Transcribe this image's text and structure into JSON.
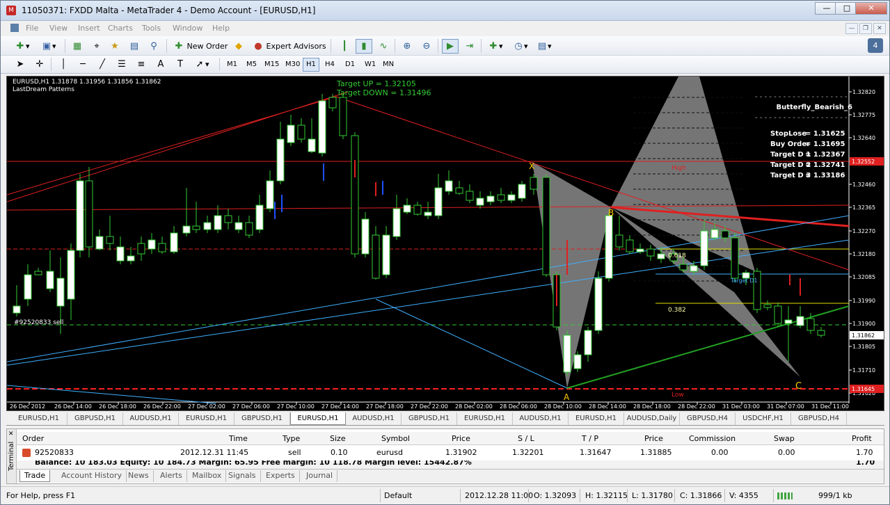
{
  "window": {
    "title": "11050371: FXDD Malta - MetaTrader 4 - Demo Account - [EURUSD,H1]"
  },
  "menu": [
    "File",
    "View",
    "Insert",
    "Charts",
    "Tools",
    "Window",
    "Help"
  ],
  "toolbar": {
    "new_order": "New Order",
    "expert_advisors": "Expert Advisors"
  },
  "timeframes": [
    "M1",
    "M5",
    "M15",
    "M30",
    "H1",
    "H4",
    "D1",
    "W1",
    "MN"
  ],
  "timeframe_selected": "H1",
  "chart": {
    "symbol_line": "EURUSD,H1  1.31878 1.31956 1.31856 1.31862",
    "indicator": "LastDream Patterns",
    "target_up": "Target UP    = 1.32105",
    "target_down": "Target DOWN = 1.31496",
    "pattern_name": "Butterfly_Bearish_6",
    "stoplose_label": "StopLose",
    "stoplose": "= 1.31625",
    "buyorder_label": "Buy Order",
    "buyorder": "= 1.31695",
    "td1_label": "Target D 1",
    "td1": "= 1.32367",
    "td2_label": "Target D 2",
    "td2": "= 1.32741",
    "td3_label": "Target D 3",
    "td3": "= 1.33186",
    "order_label": "#92520833 sell",
    "high_label": "High",
    "low_label": "Low",
    "fib_382": "0.382",
    "fib_618": "0.618",
    "target_label": "Target D1",
    "point_x": "X",
    "point_a": "A",
    "point_b": "B",
    "point_c": "C",
    "price_labels": [
      "1.32820",
      "1.32775",
      "1.32640",
      "1.32550",
      "1.32460",
      "1.32365",
      "1.32270",
      "1.32180",
      "1.32085",
      "1.31990",
      "1.31900",
      "1.31805",
      "1.31710",
      "1.31620"
    ],
    "price_hl_top": "1.32552",
    "price_hl_cur": "1.31862",
    "price_hl_low": "1.31645",
    "time_labels": [
      "26 Dec 2012",
      "26 Dec 14:00",
      "26 Dec 18:00",
      "26 Dec 22:00",
      "27 Dec 02:00",
      "27 Dec 06:00",
      "27 Dec 10:00",
      "27 Dec 14:00",
      "27 Dec 18:00",
      "27 Dec 22:00",
      "28 Dec 02:00",
      "28 Dec 06:00",
      "28 Dec 10:00",
      "28 Dec 14:00",
      "28 Dec 18:00",
      "28 Dec 22:00",
      "31 Dec 03:00",
      "31 Dec 07:00",
      "31 Dec 11:00"
    ],
    "colors": {
      "bg": "#000000",
      "bull": "#ffffff",
      "wick": "#33cc33",
      "grid": "#888888"
    }
  },
  "chart_tabs": [
    "EURUSD,H1",
    "GBPUSD,H1",
    "AUDUSD,H1",
    "EURUSD,H1",
    "GBPUSD,H1",
    "EURUSD,H1",
    "AUDUSD,H1",
    "GBPUSD,H1",
    "EURUSD,H1",
    "AUDUSD,H1",
    "EURUSD,H1",
    "AUDUSD,Daily",
    "GBPUSD,H4",
    "USDCHF,H1",
    "GBPUSD,H4"
  ],
  "chart_tab_active": 5,
  "terminal": {
    "side_label": "Terminal",
    "headers": [
      "Order",
      "Time",
      "Type",
      "Size",
      "Symbol",
      "Price",
      "S / L",
      "T / P",
      "Price",
      "Commission",
      "Swap",
      "Profit"
    ],
    "row": [
      "92520833",
      "2012.12.31 11:45",
      "sell",
      "0.10",
      "eurusd",
      "1.31902",
      "1.32201",
      "1.31647",
      "1.31885",
      "0.00",
      "0.00",
      "1.70"
    ],
    "balance": "Balance: 10 183.03  Equity: 10 184.73  Margin: 65.95  Free margin: 10 118.78  Margin level: 15442.87%",
    "balance_profit": "1.70",
    "tabs": [
      "Trade",
      "Account History",
      "News",
      "Alerts",
      "Mailbox",
      "Signals",
      "Experts",
      "Journal"
    ]
  },
  "status": {
    "help": "For Help, press F1",
    "profile": "Default",
    "time": "2012.12.28 11:00",
    "open": "O: 1.32093",
    "high": "H: 1.32115",
    "low": "L: 1.31780",
    "close": "C: 1.31866",
    "volume": "V: 4355",
    "traffic": "999/1 kb"
  }
}
